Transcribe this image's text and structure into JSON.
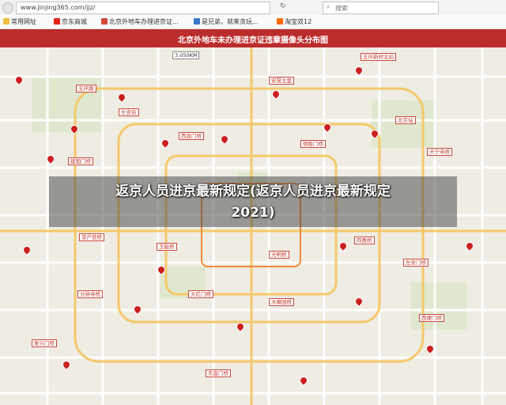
{
  "browser": {
    "url": "www.jinjing365.com/jjz/",
    "search_placeholder": "搜索"
  },
  "bookmarks": [
    "常用网址",
    "京东商城",
    "北京外地车办理进京证...",
    "是兄弟，就来贪玩...",
    "淘宝双12"
  ],
  "map": {
    "title": "北京外地车未办理进京证违章摄像头分布图",
    "speed_badge": "3.050KM"
  },
  "headline": {
    "line1": "返京人员进京最新规定(返京人员进京最新规定",
    "line2": "2021)"
  },
  "labels": [
    "五环新村北站",
    "安慧北里",
    "五环路",
    "长安街",
    "北京站",
    "西直门桥",
    "德胜门桥",
    "建国门桥",
    "天宁寺桥",
    "菜户营桥",
    "玉蜓桥",
    "四惠桥",
    "光明桥",
    "左安门桥",
    "分钟寺桥",
    "大红门桥",
    "木樨园桥",
    "西便门桥",
    "复兴门桥",
    "东直门桥"
  ],
  "colors": {
    "accent": "#bb2c2c",
    "marker": "#cc2020"
  }
}
